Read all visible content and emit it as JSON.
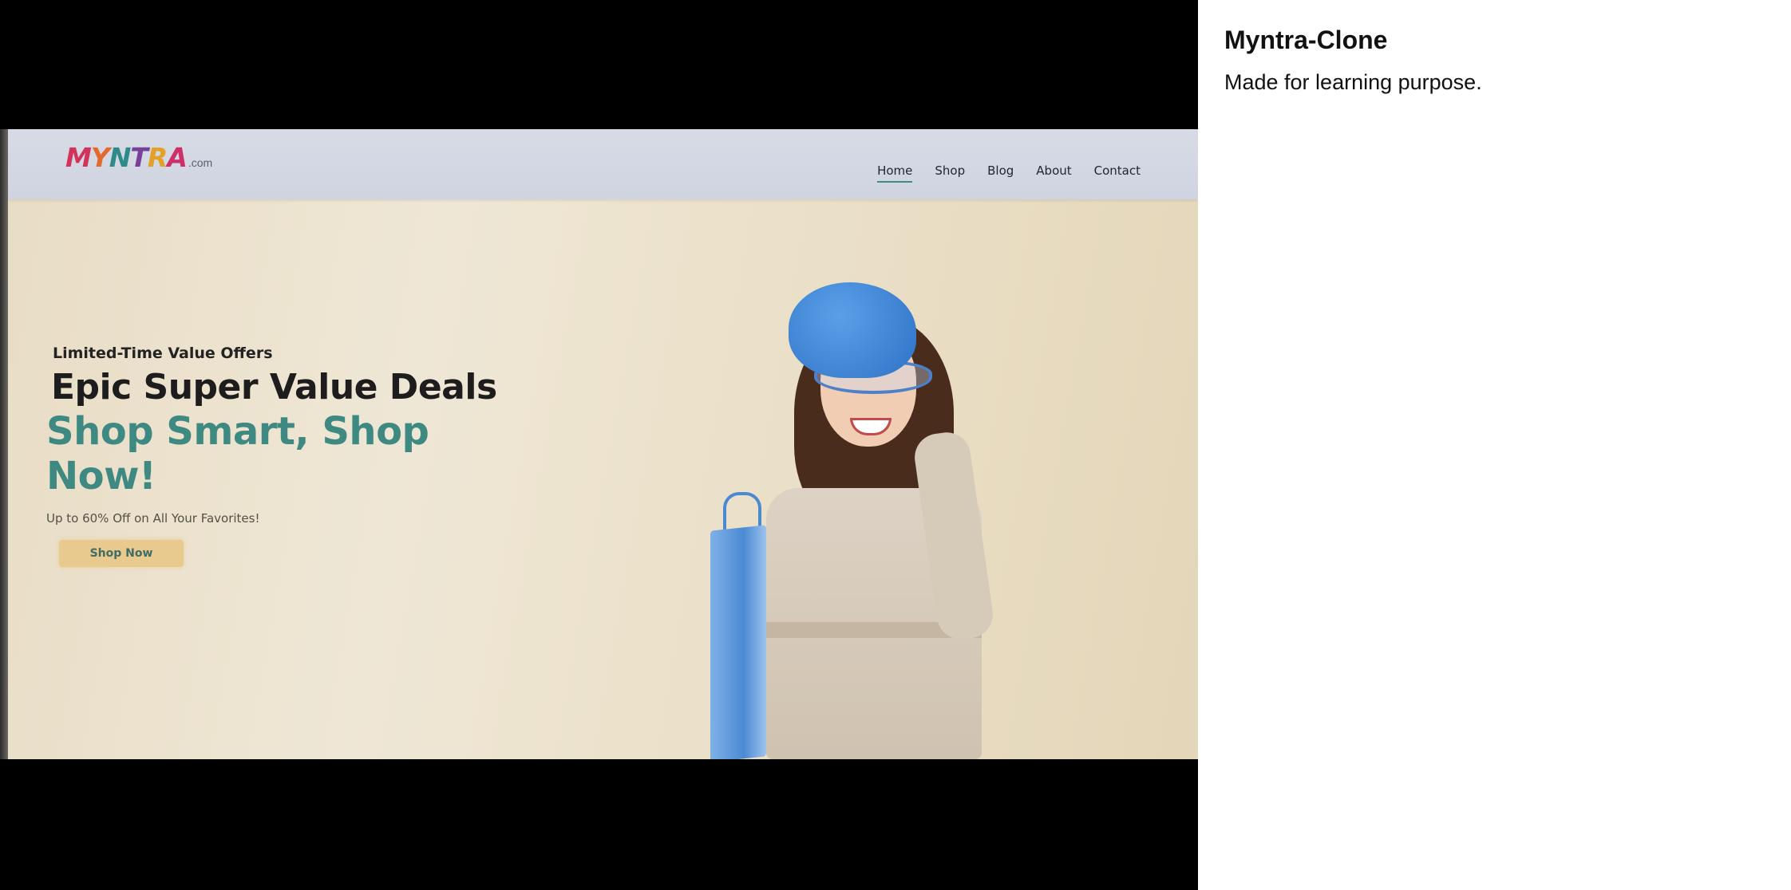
{
  "colors": {
    "accent_teal": "#3e8a82",
    "button_bg": "#e8c98e",
    "nav_bg": "#d7dbe6",
    "letterbox": "#000000"
  },
  "site": {
    "logo_text": "MYNTRA",
    "logo_suffix": ".com",
    "nav": [
      {
        "label": "Home",
        "active": true
      },
      {
        "label": "Shop",
        "active": false
      },
      {
        "label": "Blog",
        "active": false
      },
      {
        "label": "About",
        "active": false
      },
      {
        "label": "Contact",
        "active": false
      }
    ],
    "hero": {
      "kicker": "Limited-Time Value Offers",
      "title": "Epic Super Value Deals",
      "subtitle": "Shop Smart, Shop Now!",
      "description": "Up to 60% Off on All Your Favorites!",
      "button_label": "Shop Now"
    }
  },
  "info": {
    "title": "Myntra-Clone",
    "description": "Made for learning purpose."
  }
}
